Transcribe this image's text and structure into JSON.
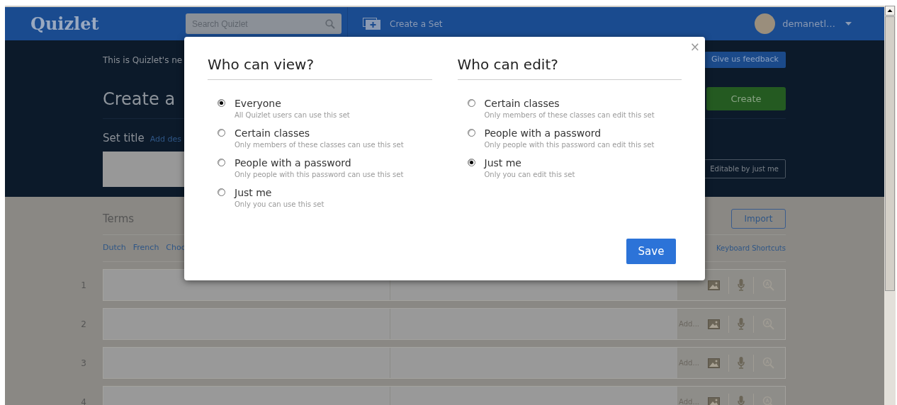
{
  "header": {
    "logo": "Quizlet",
    "search": {
      "placeholder": "Search Quizlet"
    },
    "create_set": "Create a Set",
    "user": "demanetl…"
  },
  "banner": {
    "notice": "This is Quizlet's ne",
    "feedback_button": "Give us feedback"
  },
  "title": {
    "heading": "Create a",
    "create_button": "Create"
  },
  "set_title": {
    "label": "Set title",
    "link": "Add des",
    "visibility_button": "Editable by just me"
  },
  "terms": {
    "heading": "Terms",
    "import_button": "Import",
    "languages": [
      "Dutch",
      "French",
      "Choc"
    ],
    "shortcuts_link": "Keyboard Shortcuts"
  },
  "rows": [
    {
      "number": "1"
    },
    {
      "number": "2",
      "add_label": "Add..."
    },
    {
      "number": "3",
      "add_label": "Add..."
    },
    {
      "number": "4",
      "add_label": "Add..."
    }
  ],
  "modal": {
    "close": "×",
    "sections": [
      {
        "heading": "Who can view?",
        "options": [
          {
            "label": "Everyone",
            "description": "All Quizlet users can use this set",
            "selected": true
          },
          {
            "label": "Certain classes",
            "description": "Only members of these classes can use this set",
            "selected": false
          },
          {
            "label": "People with a password",
            "description": "Only people with this password can use this set",
            "selected": false
          },
          {
            "label": "Just me",
            "description": "Only you can use this set",
            "selected": false
          }
        ]
      },
      {
        "heading": "Who can edit?",
        "options": [
          {
            "label": "Certain classes",
            "description": "Only members of these classes can edit this set",
            "selected": false
          },
          {
            "label": "People with a password",
            "description": "Only people with this password can edit this set",
            "selected": false
          },
          {
            "label": "Just me",
            "description": "Only you can edit this set",
            "selected": true
          }
        ]
      }
    ],
    "save_button": "Save"
  }
}
